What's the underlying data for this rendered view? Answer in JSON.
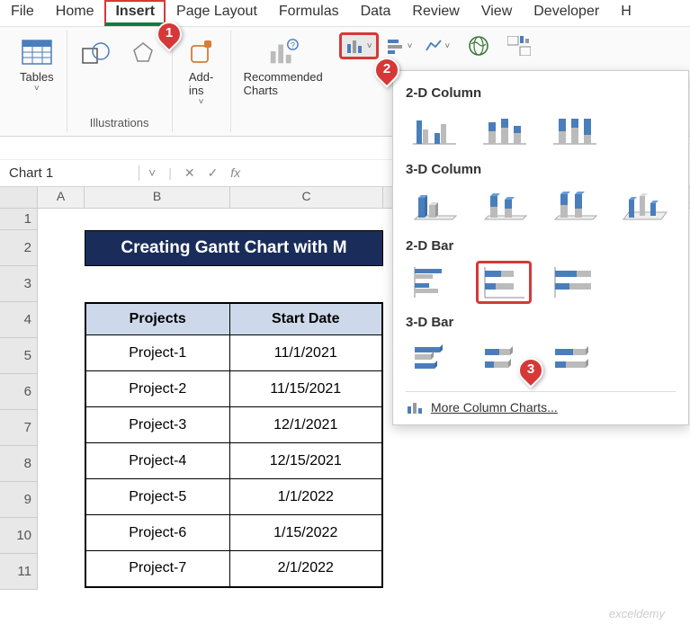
{
  "ribbon_tabs": [
    "File",
    "Home",
    "Insert",
    "Page Layout",
    "Formulas",
    "Data",
    "Review",
    "View",
    "Developer",
    "H"
  ],
  "active_tab": 2,
  "groups": {
    "tables": "Tables",
    "illustrations": "Illustrations",
    "addins": "Add-\nins",
    "recommended": "Recommended\nCharts"
  },
  "namebox": "Chart 1",
  "formula_controls": {
    "down": "˅",
    "cancel": "✕",
    "confirm": "✓",
    "fx": "fx"
  },
  "columns": [
    "A",
    "B",
    "C"
  ],
  "rows": [
    "1",
    "2",
    "3",
    "4",
    "5",
    "6",
    "7",
    "8",
    "9",
    "10",
    "11"
  ],
  "title_banner": "Creating Gantt Chart with M",
  "table": {
    "headers": [
      "Projects",
      "Start Date"
    ],
    "rows": [
      [
        "Project-1",
        "11/1/2021"
      ],
      [
        "Project-2",
        "11/15/2021"
      ],
      [
        "Project-3",
        "12/1/2021"
      ],
      [
        "Project-4",
        "12/15/2021"
      ],
      [
        "Project-5",
        "1/1/2022"
      ],
      [
        "Project-6",
        "1/15/2022"
      ],
      [
        "Project-7",
        "2/1/2022"
      ]
    ]
  },
  "dropdown": {
    "sections": [
      "2-D Column",
      "3-D Column",
      "2-D Bar",
      "3-D Bar"
    ],
    "footer": "More Column Charts..."
  },
  "markers": {
    "m1": "1",
    "m2": "2",
    "m3": "3"
  },
  "watermark": "exceldemy"
}
